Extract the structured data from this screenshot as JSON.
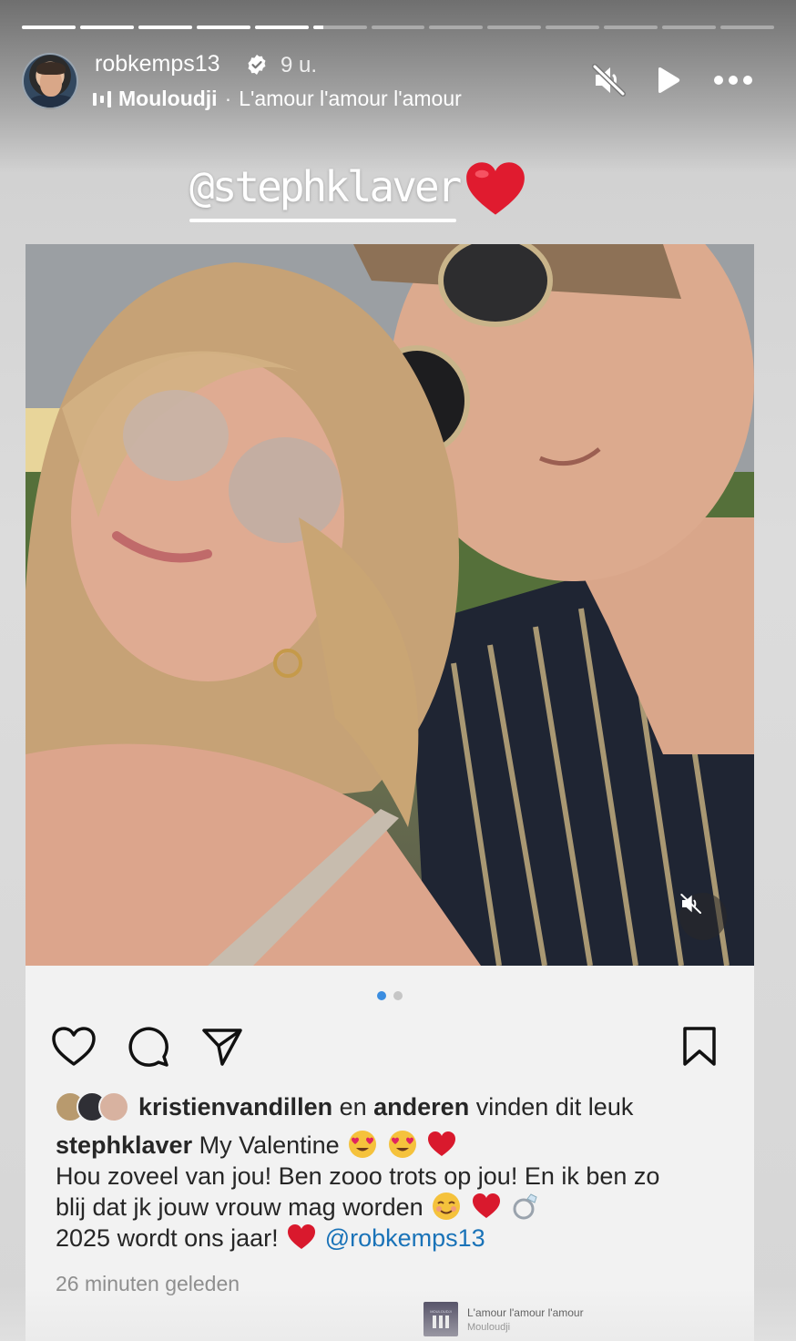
{
  "story": {
    "progress": {
      "total_segments": 13,
      "completed_segments": 5,
      "current_segment_fraction": 0.2
    },
    "header": {
      "username": "robkemps13",
      "verified": true,
      "time_ago": "9 u.",
      "music_artist": "Mouloudji",
      "music_separator": "·",
      "music_title": "L'amour l'amour l'amour",
      "icons": [
        "mute-icon",
        "play-icon",
        "more-icon"
      ]
    },
    "mention_sticker": {
      "text": "@stephklaver",
      "emoji": "red-heart"
    }
  },
  "post": {
    "carousel": {
      "count": 2,
      "active_index": 0
    },
    "actions": [
      "like-icon",
      "comment-icon",
      "share-icon",
      "save-icon"
    ],
    "likes": {
      "first_liker": "kristienvandillen",
      "connector": "en",
      "others": "anderen",
      "suffix": "vinden dit leuk"
    },
    "caption": {
      "username": "stephklaver",
      "line1": "My Valentine",
      "line2": "Hou zoveel van jou! Ben zooo trots op jou! En ik ben zo",
      "line3": "blij dat jk jouw vrouw mag worden",
      "line4": "2025 wordt ons jaar!",
      "mention": "@robkemps13"
    },
    "time_ago": "26 minuten geleden"
  },
  "music_sticker": {
    "cover_text": "MOULOUDJI",
    "title": "L'amour l'amour l'amour",
    "artist": "Mouloudji"
  },
  "colors": {
    "link": "#1a73b8",
    "carousel_active": "#3b8de0",
    "heart": "#e0245e"
  }
}
